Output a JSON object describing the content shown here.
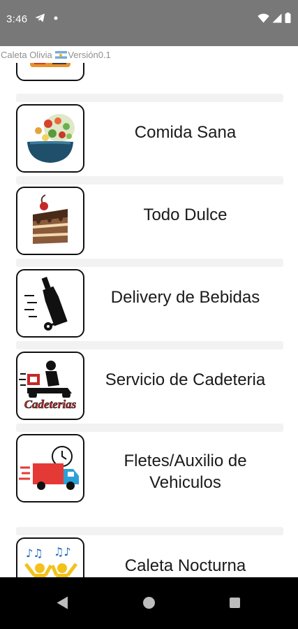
{
  "status_bar": {
    "time": "3:46",
    "left_icons": [
      "telegram-icon",
      "dot-icon"
    ],
    "right_icons": [
      "wifi-icon",
      "signal-icon",
      "battery-icon"
    ]
  },
  "app_header": {
    "title": "Caleta Olivia",
    "version": "Versión0.1",
    "flag": "argentina-flag"
  },
  "categories": [
    {
      "label": "",
      "icon": "food-bag-icon"
    },
    {
      "label": "Comida Sana",
      "icon": "salad-bowl-icon"
    },
    {
      "label": "Todo Dulce",
      "icon": "cake-slice-icon"
    },
    {
      "label": "Delivery de Bebidas",
      "icon": "bottle-cart-icon"
    },
    {
      "label": "Servicio de Cadeteria",
      "icon": "courier-scooter-icon",
      "icon_text": "Cadeterias"
    },
    {
      "label": "Fletes/Auxilio de Vehiculos",
      "icon": "delivery-truck-icon"
    },
    {
      "label": "Caleta Nocturna",
      "icon": "party-people-icon"
    }
  ],
  "nav_bar": {
    "buttons": [
      "back-icon",
      "home-icon",
      "recents-icon"
    ]
  },
  "colors": {
    "status_bar": "#787878",
    "card_strip": "#f2f2f2",
    "nav_bar": "#000000",
    "header_text": "#8f8f8f"
  }
}
